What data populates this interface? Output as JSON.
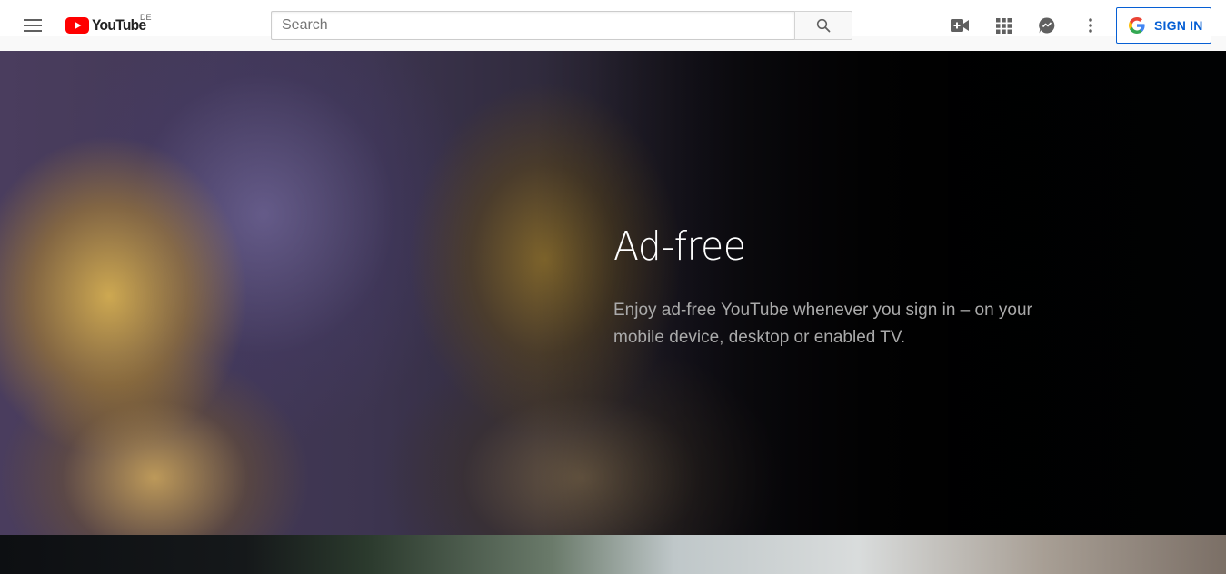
{
  "masthead": {
    "menu_icon": "hamburger-menu-icon",
    "logo": {
      "text": "YouTube",
      "country_code": "DE",
      "brand_color": "#ff0000"
    },
    "search": {
      "placeholder": "Search",
      "value": "",
      "button_icon": "search-icon"
    },
    "actions": [
      {
        "icon": "video-camera-add-icon"
      },
      {
        "icon": "apps-grid-icon"
      },
      {
        "icon": "messages-icon"
      },
      {
        "icon": "more-vert-icon"
      }
    ],
    "sign_in": {
      "label": "SIGN IN",
      "icon": "google-g-icon",
      "color": "#065fd4"
    }
  },
  "hero": {
    "title": "Ad-free",
    "description": "Enjoy ad-free YouTube whenever you sign in – on your mobile device, desktop or enabled TV."
  },
  "colors": {
    "text_primary": "#ffffff",
    "text_secondary": "#aaaaaa",
    "accent": "#065fd4"
  }
}
